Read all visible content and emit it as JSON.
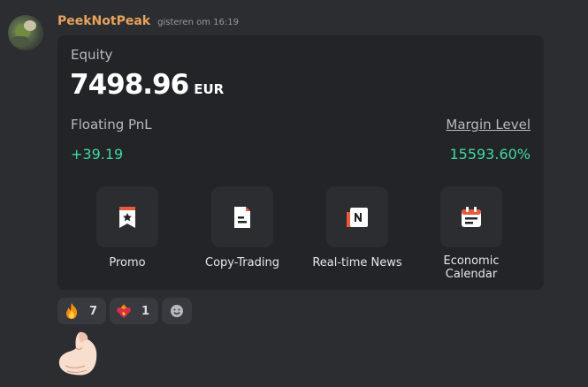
{
  "message": {
    "username": "PeekNotPeak",
    "timestamp": "gisteren om 16:19"
  },
  "card": {
    "equity_label": "Equity",
    "equity_value": "7498.96",
    "equity_currency": "EUR",
    "floating_pnl_label": "Floating PnL",
    "floating_pnl_value": "+39.19",
    "margin_level_label": "Margin Level",
    "margin_level_value": "15593.60%",
    "actions": [
      {
        "label": "Promo",
        "icon": "bookmark-star-icon"
      },
      {
        "label": "Copy-Trading",
        "icon": "document-icon"
      },
      {
        "label": "Real-time News",
        "icon": "news-icon"
      },
      {
        "label_line1": "Economic",
        "label_line2": "Calendar",
        "icon": "calendar-icon"
      }
    ]
  },
  "reactions": [
    {
      "emoji": "fire-icon",
      "count": "7"
    },
    {
      "emoji": "heart-on-fire-icon",
      "count": "1"
    }
  ],
  "colors": {
    "background": "#2b2d31",
    "card": "#232428",
    "username": "#e8a35c",
    "positive": "#3fd9a0",
    "icon_accent": "#e85a3c"
  }
}
